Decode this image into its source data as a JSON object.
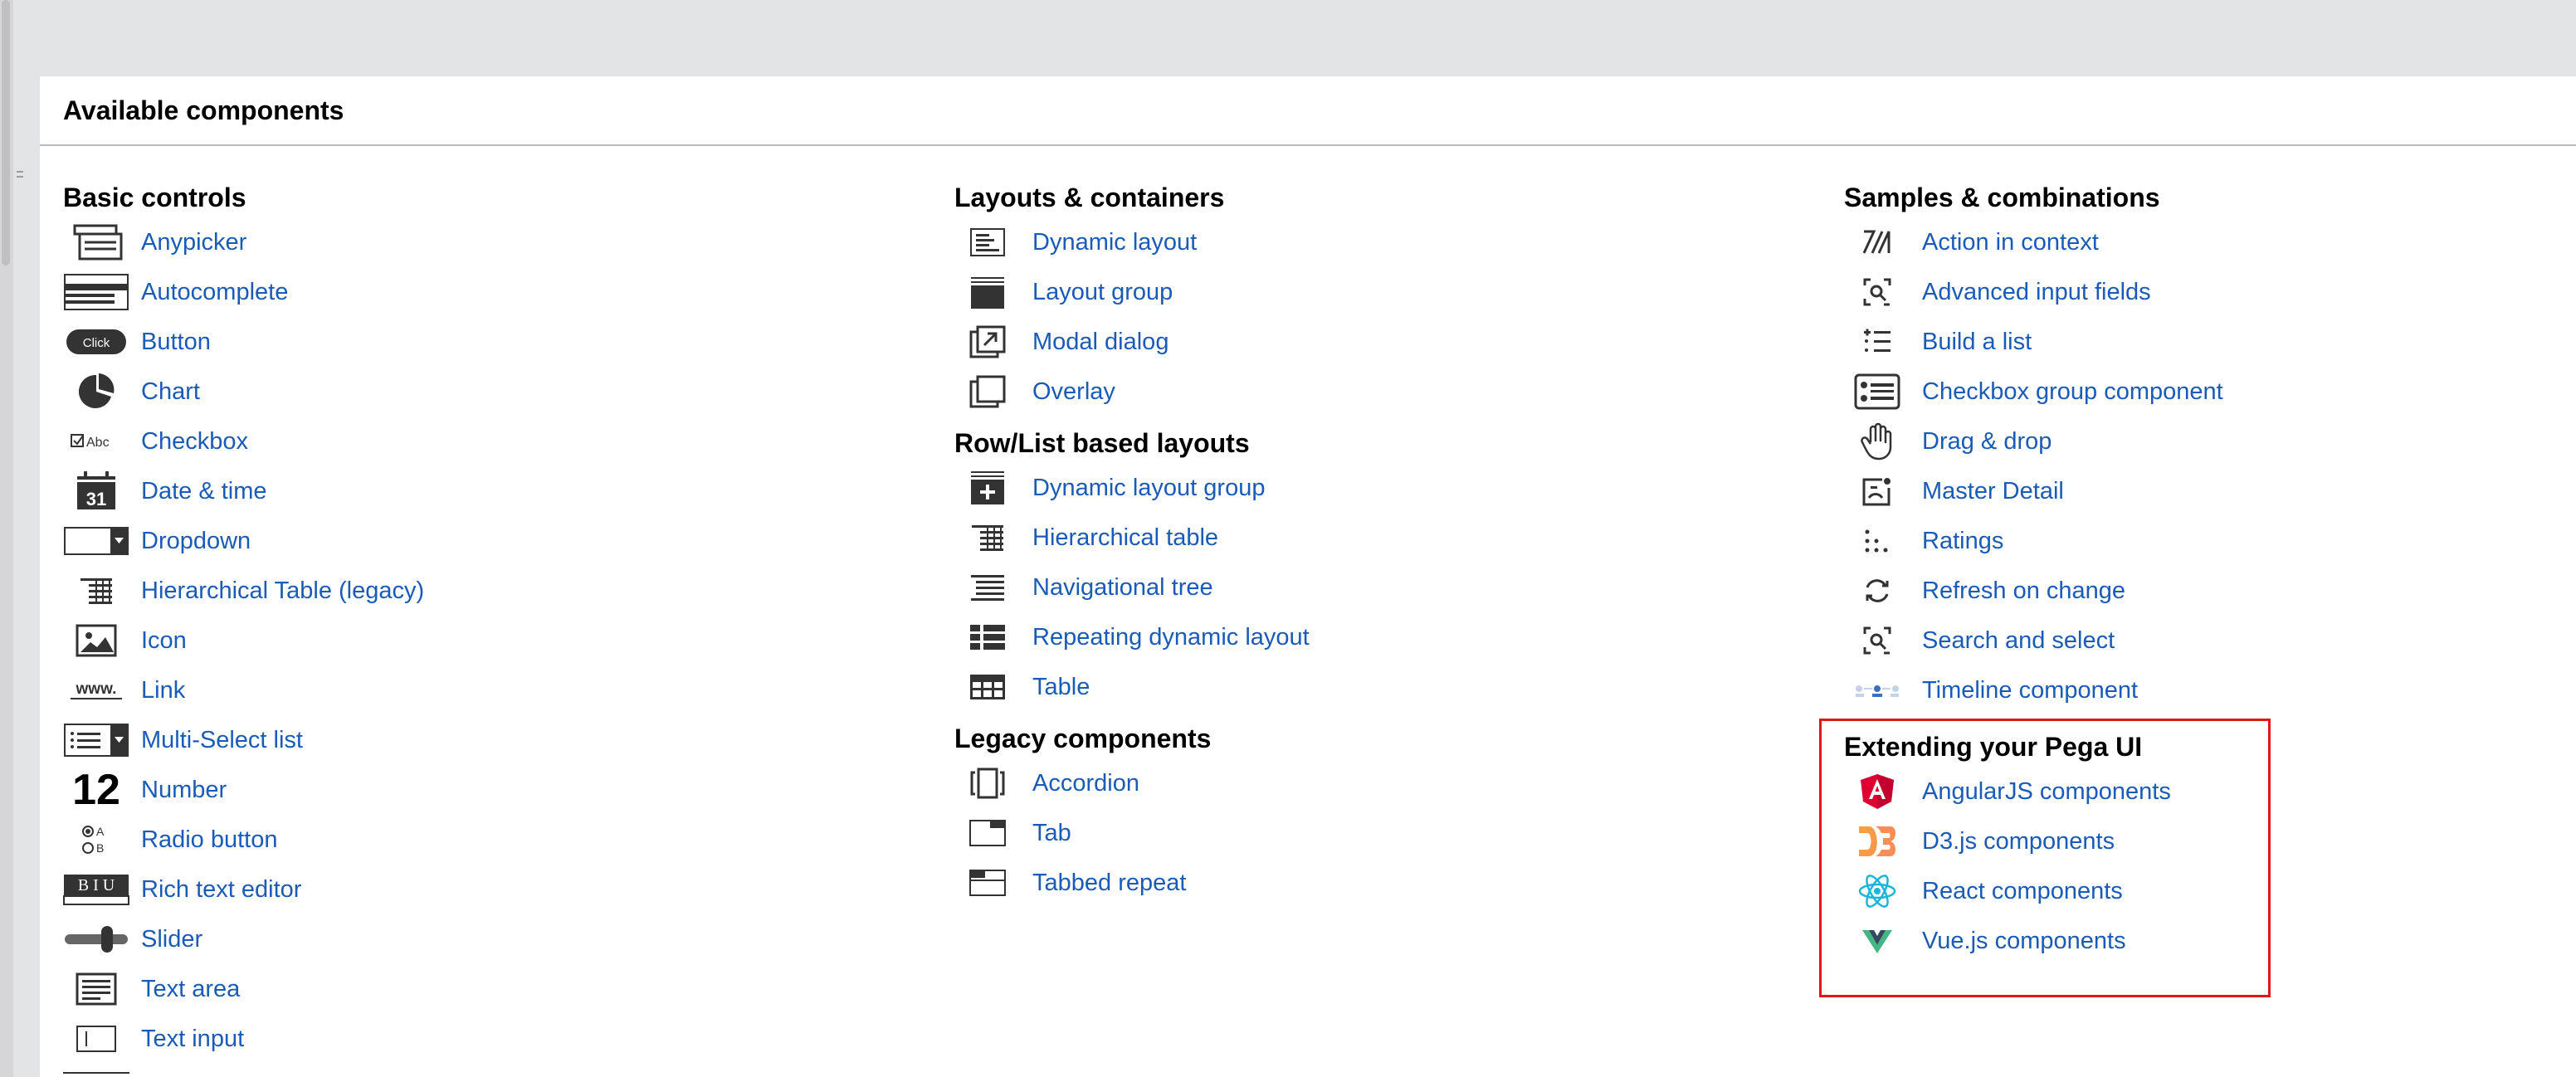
{
  "panel": {
    "title": "Available components"
  },
  "highlight_color": "#e0161b",
  "basic_controls": {
    "heading": "Basic controls",
    "items": [
      {
        "label": "Anypicker",
        "icon": "anypicker-icon"
      },
      {
        "label": "Autocomplete",
        "icon": "autocomplete-icon"
      },
      {
        "label": "Button",
        "icon": "button-icon",
        "icon_text": "Click"
      },
      {
        "label": "Chart",
        "icon": "chart-icon"
      },
      {
        "label": "Checkbox",
        "icon": "checkbox-icon",
        "icon_text": "Abc"
      },
      {
        "label": "Date & time",
        "icon": "calendar-icon",
        "icon_text": "31"
      },
      {
        "label": "Dropdown",
        "icon": "dropdown-icon"
      },
      {
        "label": "Hierarchical Table (legacy)",
        "icon": "hierarchical-table-icon"
      },
      {
        "label": "Icon",
        "icon": "image-icon"
      },
      {
        "label": "Link",
        "icon": "link-icon",
        "icon_text": "www."
      },
      {
        "label": "Multi-Select list",
        "icon": "multiselect-icon"
      },
      {
        "label": "Number",
        "icon": "number-icon",
        "icon_text": "12"
      },
      {
        "label": "Radio button",
        "icon": "radio-icon",
        "icon_text_a": "A",
        "icon_text_b": "B"
      },
      {
        "label": "Rich text editor",
        "icon": "rich-text-icon",
        "icon_text": "B I U"
      },
      {
        "label": "Slider",
        "icon": "slider-icon"
      },
      {
        "label": "Text area",
        "icon": "text-area-icon"
      },
      {
        "label": "Text input",
        "icon": "text-input-icon"
      }
    ]
  },
  "layouts": {
    "heading": "Layouts & containers",
    "items": [
      {
        "label": "Dynamic layout",
        "icon": "dynamic-layout-icon"
      },
      {
        "label": "Layout group",
        "icon": "layout-group-icon"
      },
      {
        "label": "Modal dialog",
        "icon": "modal-dialog-icon"
      },
      {
        "label": "Overlay",
        "icon": "overlay-icon"
      }
    ]
  },
  "row_list": {
    "heading": "Row/List based layouts",
    "items": [
      {
        "label": "Dynamic layout group",
        "icon": "dynamic-layout-group-icon"
      },
      {
        "label": "Hierarchical table",
        "icon": "hierarchical-table-icon"
      },
      {
        "label": "Navigational tree",
        "icon": "navigational-tree-icon"
      },
      {
        "label": "Repeating dynamic layout",
        "icon": "repeating-layout-icon"
      },
      {
        "label": "Table",
        "icon": "table-icon"
      }
    ]
  },
  "legacy": {
    "heading": "Legacy components",
    "items": [
      {
        "label": "Accordion",
        "icon": "accordion-icon"
      },
      {
        "label": "Tab",
        "icon": "tab-icon"
      },
      {
        "label": "Tabbed repeat",
        "icon": "tabbed-repeat-icon"
      }
    ]
  },
  "samples": {
    "heading": "Samples & combinations",
    "items": [
      {
        "label": "Action in context",
        "icon": "action-icon"
      },
      {
        "label": "Advanced input fields",
        "icon": "focus-search-icon"
      },
      {
        "label": "Build a list",
        "icon": "build-list-icon"
      },
      {
        "label": "Checkbox group component",
        "icon": "checkbox-group-icon"
      },
      {
        "label": "Drag & drop",
        "icon": "hand-icon"
      },
      {
        "label": "Master Detail",
        "icon": "master-detail-icon"
      },
      {
        "label": "Ratings",
        "icon": "ratings-icon"
      },
      {
        "label": "Refresh on change",
        "icon": "refresh-icon"
      },
      {
        "label": "Search and select",
        "icon": "focus-search-icon"
      },
      {
        "label": "Timeline component",
        "icon": "timeline-icon"
      }
    ]
  },
  "extending": {
    "heading": "Extending your Pega UI",
    "items": [
      {
        "label": "AngularJS components",
        "icon": "angular-icon",
        "color": "#dd0031"
      },
      {
        "label": "D3.js components",
        "icon": "d3-icon",
        "color": "#f68e56"
      },
      {
        "label": "React components",
        "icon": "react-icon",
        "color": "#1ab5da"
      },
      {
        "label": "Vue.js components",
        "icon": "vue-icon",
        "color": "#41b883"
      }
    ]
  }
}
